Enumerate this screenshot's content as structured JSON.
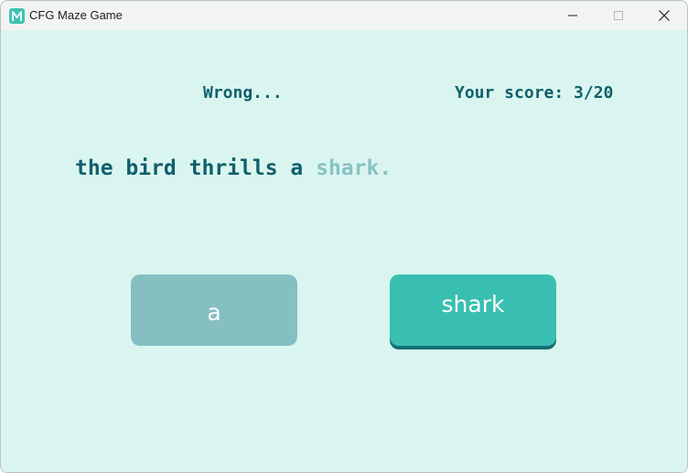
{
  "window": {
    "title": "CFG Maze Game",
    "app_icon": "m-logo-icon",
    "controls": [
      "minimize-icon",
      "maximize-icon",
      "close-icon"
    ]
  },
  "game": {
    "status": "Wrong...",
    "score": "Your score: 3/20",
    "sentence_prefix": "the bird thrills a ",
    "sentence_highlight": "shark.",
    "options": [
      {
        "label": "a",
        "state": "disabled"
      },
      {
        "label": "shark",
        "state": "correct"
      }
    ]
  },
  "colors": {
    "background": "#daf5f0",
    "text_primary": "#0f5f6c",
    "text_highlight": "#88c2c4",
    "button_disabled": "#86bfc2",
    "button_active": "#39bfb1",
    "button_shadow": "#137074"
  }
}
